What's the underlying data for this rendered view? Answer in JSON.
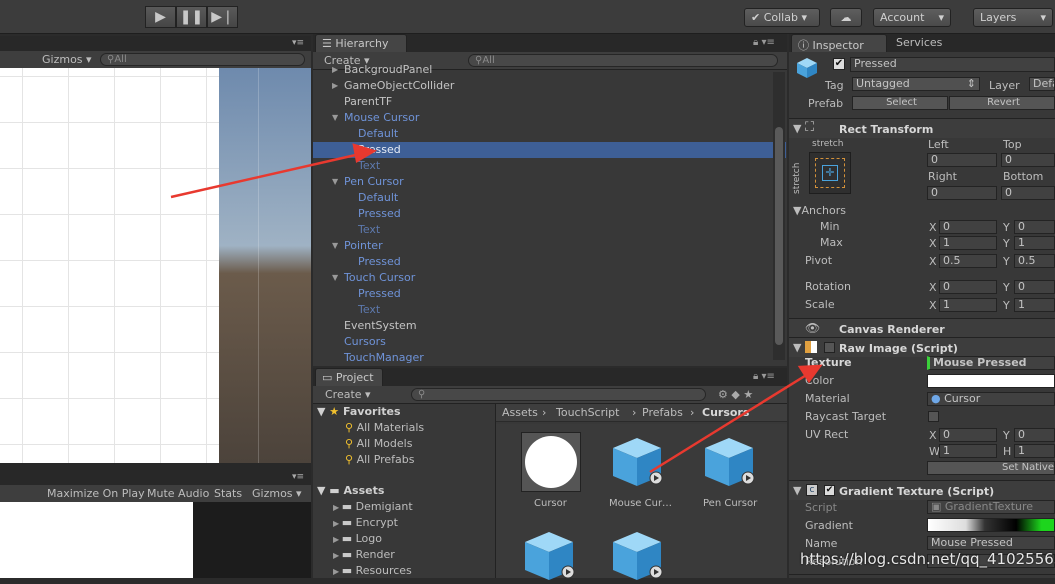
{
  "toolbar": {
    "collab": "Collab",
    "account": "Account",
    "layers": "Layers",
    "play_icon": "play-icon",
    "pause_icon": "pause-icon",
    "step_icon": "step-icon"
  },
  "scene": {
    "gizmos": "Gizmos",
    "search_placeholder": "All"
  },
  "game": {
    "maximize": "Maximize On Play",
    "mute": "Mute Audio",
    "stats": "Stats",
    "gizmos": "Gizmos"
  },
  "hierarchy": {
    "tab": "Hierarchy",
    "create": "Create",
    "search_placeholder": "All",
    "items": [
      {
        "label": "BackgroudPanel",
        "indent": 1,
        "arrow": "▶",
        "color": "white"
      },
      {
        "label": "GameObjectCollider",
        "indent": 1,
        "arrow": "▶",
        "color": "white"
      },
      {
        "label": "ParentTF",
        "indent": 1,
        "arrow": "",
        "color": "white"
      },
      {
        "label": "Mouse Cursor",
        "indent": 1,
        "arrow": "▼",
        "color": "blue"
      },
      {
        "label": "Default",
        "indent": 2,
        "arrow": "",
        "color": "blue"
      },
      {
        "label": "Pressed",
        "indent": 2,
        "arrow": "",
        "color": "blue",
        "selected": true
      },
      {
        "label": "Text",
        "indent": 2,
        "arrow": "",
        "color": "dim"
      },
      {
        "label": "Pen Cursor",
        "indent": 1,
        "arrow": "▼",
        "color": "blue"
      },
      {
        "label": "Default",
        "indent": 2,
        "arrow": "",
        "color": "blue"
      },
      {
        "label": "Pressed",
        "indent": 2,
        "arrow": "",
        "color": "blue"
      },
      {
        "label": "Text",
        "indent": 2,
        "arrow": "",
        "color": "dim"
      },
      {
        "label": "Pointer",
        "indent": 1,
        "arrow": "▼",
        "color": "blue"
      },
      {
        "label": "Pressed",
        "indent": 2,
        "arrow": "",
        "color": "blue"
      },
      {
        "label": "Touch Cursor",
        "indent": 1,
        "arrow": "▼",
        "color": "blue"
      },
      {
        "label": "Pressed",
        "indent": 2,
        "arrow": "",
        "color": "blue"
      },
      {
        "label": "Text",
        "indent": 2,
        "arrow": "",
        "color": "dim"
      },
      {
        "label": "EventSystem",
        "indent": 0,
        "arrow": "",
        "color": "white"
      },
      {
        "label": "Cursors",
        "indent": 0,
        "arrow": "",
        "color": "blue"
      },
      {
        "label": "TouchManager",
        "indent": 0,
        "arrow": "",
        "color": "blue"
      }
    ]
  },
  "project": {
    "tab": "Project",
    "create": "Create",
    "favorites": {
      "label": "Favorites",
      "items": [
        "All Materials",
        "All Models",
        "All Prefabs"
      ]
    },
    "assets": {
      "label": "Assets",
      "items": [
        "Demigiant",
        "Encrypt",
        "Logo",
        "Render",
        "Resources"
      ]
    },
    "breadcrumb": [
      "Assets",
      "TouchScript",
      "Prefabs",
      "Cursors"
    ],
    "grid": [
      {
        "label": "Cursor",
        "kind": "circle"
      },
      {
        "label": "Mouse Cur…",
        "kind": "cube"
      },
      {
        "label": "Pen Cursor",
        "kind": "cube"
      },
      {
        "label": "",
        "kind": "cube"
      },
      {
        "label": "",
        "kind": "cube"
      }
    ]
  },
  "inspector": {
    "tab": "Inspector",
    "tab2": "Services",
    "name": "Pressed",
    "tag_label": "Tag",
    "tag_value": "Untagged",
    "layer_label": "Layer",
    "layer_value": "Defa",
    "prefab_label": "Prefab",
    "select": "Select",
    "revert": "Revert",
    "rect": {
      "title": "Rect Transform",
      "stretch_top": "stretch",
      "stretch_side": "stretch",
      "left": "Left",
      "top": "Top",
      "right": "Right",
      "bottom": "Bottom",
      "left_v": "0",
      "top_v": "0",
      "right_v": "0",
      "bottom_v": "0",
      "anchors": "Anchors",
      "min": "Min",
      "max": "Max",
      "pivot": "Pivot",
      "rotation": "Rotation",
      "scale": "Scale",
      "x": "X",
      "y": "Y",
      "min_x": "0",
      "min_y": "0",
      "max_x": "1",
      "max_y": "1",
      "pivot_x": "0.5",
      "pivot_y": "0.5",
      "rot_x": "0",
      "rot_y": "0",
      "scale_x": "1",
      "scale_y": "1"
    },
    "canvas_renderer": "Canvas Renderer",
    "raw": {
      "title": "Raw Image (Script)",
      "texture": "Texture",
      "texture_v": "Mouse Pressed",
      "color": "Color",
      "material": "Material",
      "material_v": "Cursor",
      "raycast": "Raycast Target",
      "uvrect": "UV Rect",
      "x": "X",
      "y": "Y",
      "w": "W",
      "h": "H",
      "uv_x": "0",
      "uv_y": "0",
      "uv_w": "1",
      "uv_h": "1",
      "native": "Set Native"
    },
    "grad": {
      "title": "Gradient Texture (Script)",
      "script": "Script",
      "script_v": "GradientTexture",
      "gradient": "Gradient",
      "name": "Name",
      "name_v": "Mouse Pressed",
      "resolution": "Resolution"
    }
  },
  "watermark": "https://blog.csdn.net/qq_41025563"
}
